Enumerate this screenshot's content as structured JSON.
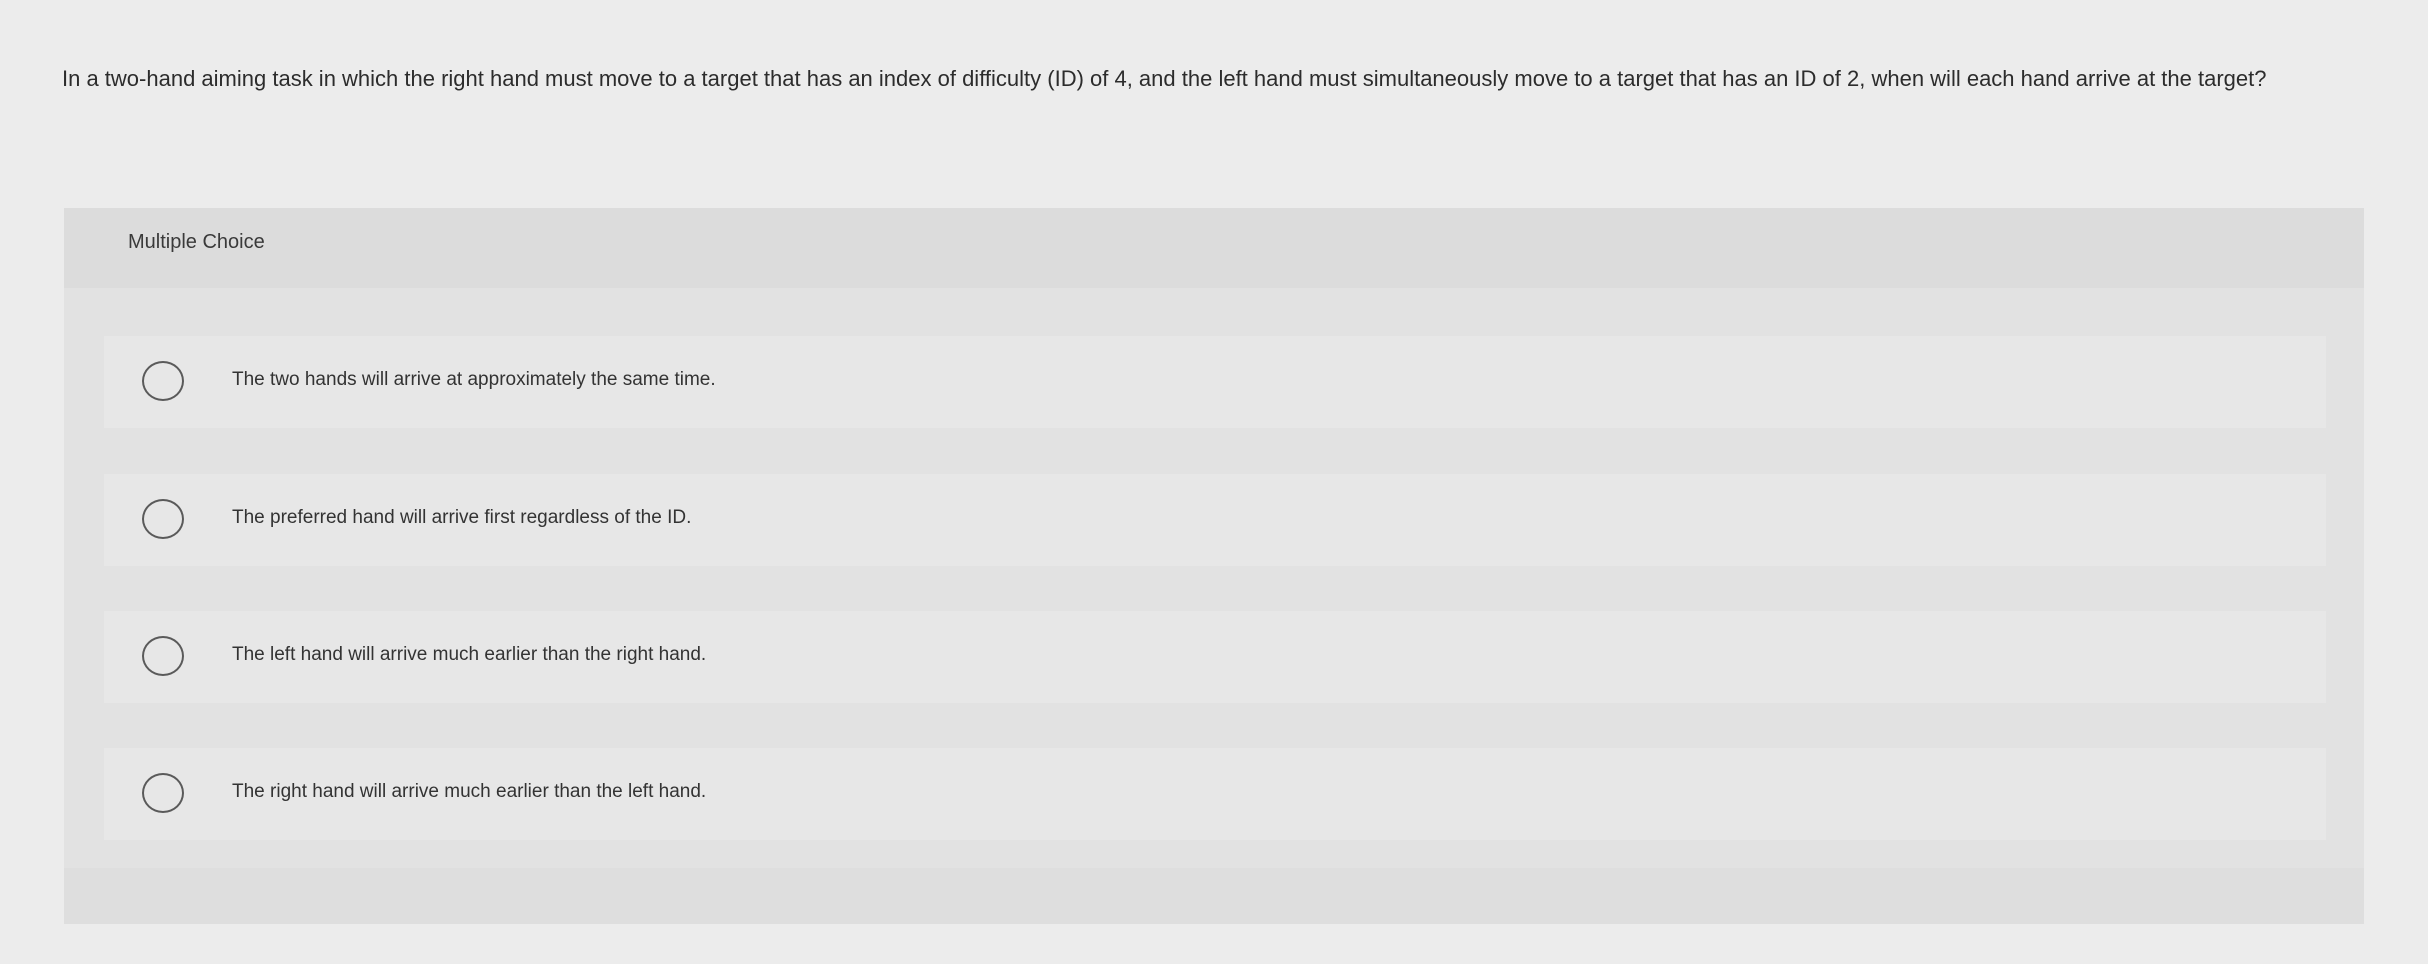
{
  "question": {
    "text": "In a two-hand aiming task in which the right hand must move to a target that has an index of difficulty (ID) of 4, and the left hand must simultaneously move to a target that has an ID of 2, when will each hand arrive at the target?"
  },
  "panel": {
    "title": "Multiple Choice"
  },
  "choices": [
    {
      "label": "The two hands will arrive at approximately the same time.",
      "selected": false
    },
    {
      "label": "The preferred hand will arrive first regardless of the ID.",
      "selected": false
    },
    {
      "label": "The left hand will arrive much earlier than the right hand.",
      "selected": false
    },
    {
      "label": "The right hand will arrive much earlier than the left hand.",
      "selected": false
    }
  ],
  "colors": {
    "background": "#ececec",
    "panel": "#e2e2e2",
    "choice_row": "#e7e7e7",
    "radio_border": "#5a5a5a",
    "text": "#2e2e2e"
  }
}
